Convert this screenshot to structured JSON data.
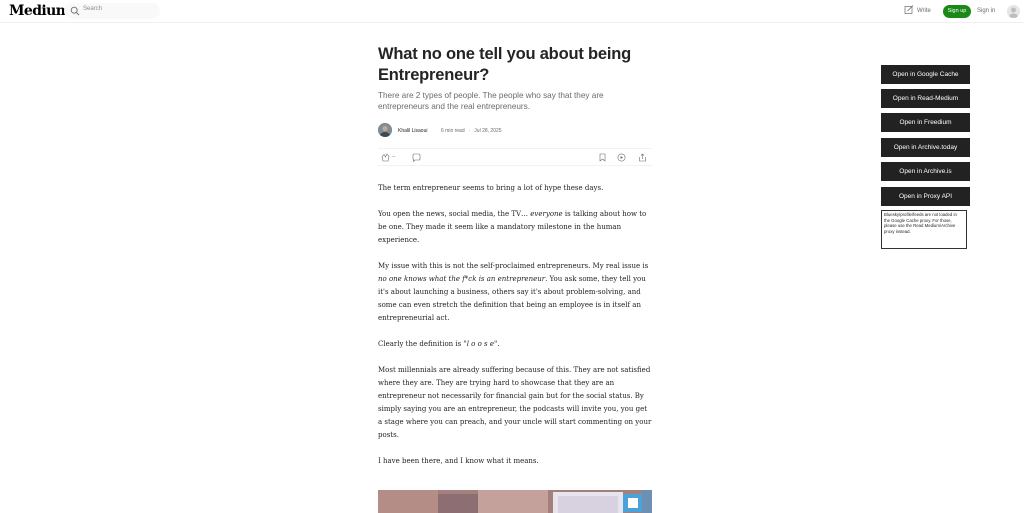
{
  "nav": {
    "logo": "Medium",
    "search_placeholder": "Search",
    "write_label": "Write",
    "signup_label": "Sign up",
    "signin_label": "Sign in"
  },
  "article": {
    "title": "What no one tell you about being Entrepreneur?",
    "subtitle": "There are 2 types of people. The people who say that they are entrepreneurs and the real entrepreneurs.",
    "author": "Khalil Lisaoui",
    "read_time": "6 min read",
    "separator": "·",
    "date": "Jul 28, 2025",
    "clap_count": "--",
    "paragraphs": {
      "p1": "The term entrepreneur seems to bring a lot of hype these days.",
      "p2_a": "You open the news, social media, the TV… ",
      "p2_em": "everyone",
      "p2_b": " is talking about how to be one. They made it seem like a mandatory milestone in the human experience.",
      "p3_a": "My issue with this is not the self-proclaimed entrepreneurs. My real issue is ",
      "p3_em": "no one knows what the f*ck is an entrepreneur",
      "p3_b": ". You ask some, they tell you it's about launching a business, others say it's about problem-solving, and some can even stretch the definition that being an employee is in itself an entrepreneurial act.",
      "p4_a": "Clearly the definition is \"",
      "p4_em": "l o o s e",
      "p4_b": "\".",
      "p5": "Most millennials are already suffering because of this. They are not satisfied where they are. They are trying hard to showcase that they are an entrepreneur not necessarily for financial gain but for the social status. By simply saying you are an entrepreneur, the podcasts will invite you, you get a stage where you can preach, and your uncle will start commenting on your posts.",
      "p6": "I have been there, and I know what it means."
    }
  },
  "side_panel": {
    "buttons": [
      "Open in Google Cache",
      "Open in Read-Medium",
      "Open in Freedium",
      "Open in Archive.today",
      "Open in Archive.is",
      "Open in Proxy API"
    ],
    "note": "Bluesky/profile/feeds are not loaded in the Google Cache proxy. For those, please use the Read Medium/Archive proxy instead."
  },
  "colors": {
    "accent_green": "#1a8917",
    "side_button_bg": "#222222"
  }
}
